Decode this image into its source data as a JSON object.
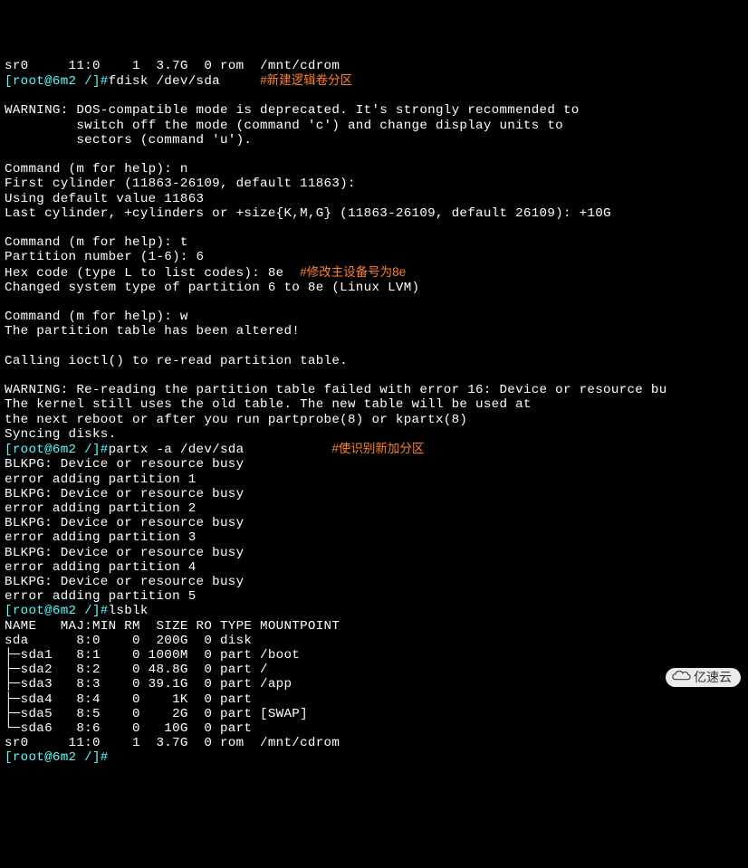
{
  "prompt_prefix": "[root@6m2 /]#",
  "top_line": "sr0     11:0    1  3.7G  0 rom  /mnt/cdrom",
  "cmd1": "fdisk /dev/sda",
  "anno1": "#新建逻辑卷分区",
  "block1": "\nWARNING: DOS-compatible mode is deprecated. It's strongly recommended to\n         switch off the mode (command 'c') and change display units to\n         sectors (command 'u').\n\nCommand (m for help): n\nFirst cylinder (11863-26109, default 11863):\nUsing default value 11863\nLast cylinder, +cylinders or +size{K,M,G} (11863-26109, default 26109): +10G\n\nCommand (m for help): t\nPartition number (1-6): 6\nHex code (type L to list codes): 8e",
  "anno2": "#修改主设备号为8e",
  "block2": "Changed system type of partition 6 to 8e (Linux LVM)\n\nCommand (m for help): w\nThe partition table has been altered!\n\nCalling ioctl() to re-read partition table.\n\nWARNING: Re-reading the partition table failed with error 16: Device or resource bu\nThe kernel still uses the old table. The new table will be used at\nthe next reboot or after you run partprobe(8) or kpartx(8)\nSyncing disks.",
  "cmd2": "partx -a /dev/sda",
  "anno3": "#使识别新加分区",
  "block3": "BLKPG: Device or resource busy\nerror adding partition 1\nBLKPG: Device or resource busy\nerror adding partition 2\nBLKPG: Device or resource busy\nerror adding partition 3\nBLKPG: Device or resource busy\nerror adding partition 4\nBLKPG: Device or resource busy\nerror adding partition 5",
  "cmd3": "lsblk",
  "lsblk_header": "NAME   MAJ:MIN RM  SIZE RO TYPE MOUNTPOINT",
  "lsblk_rows": [
    "sda      8:0    0  200G  0 disk",
    "├─sda1   8:1    0 1000M  0 part /boot",
    "├─sda2   8:2    0 48.8G  0 part /",
    "├─sda3   8:3    0 39.1G  0 part /app",
    "├─sda4   8:4    0    1K  0 part",
    "├─sda5   8:5    0    2G  0 part [SWAP]",
    "└─sda6   8:6    0   10G  0 part",
    "sr0     11:0    1  3.7G  0 rom  /mnt/cdrom"
  ],
  "watermark_text": "亿速云"
}
